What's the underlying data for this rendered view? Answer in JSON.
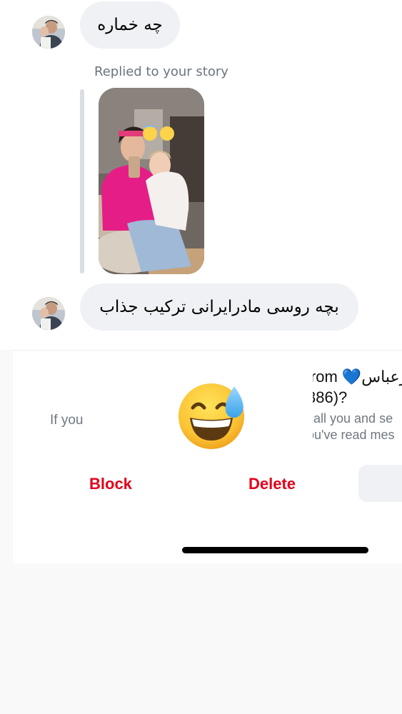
{
  "messages": [
    {
      "text": "چه خماره"
    },
    {
      "text": "بچه روسی مادرایرانی ترکیب جذاب"
    }
  ],
  "story_reply": {
    "label": "Replied to your story",
    "emojis": "😇😌"
  },
  "request_sheet": {
    "title_line1": "’rom 💙رعباس",
    "title_line2": "386)?",
    "desc_line1": "call you and se",
    "desc_line2": "ou've read mes",
    "intro_fragment": "If you",
    "emoji": "sweat-smile"
  },
  "actions": {
    "block_label": "Block",
    "delete_label": "Delete"
  },
  "colors": {
    "danger": "#e1001a",
    "bubble": "#eff1f4",
    "muted_text": "#6b7480"
  }
}
